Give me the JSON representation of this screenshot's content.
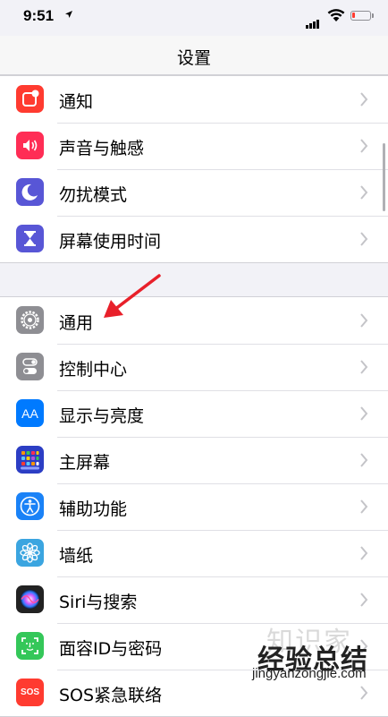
{
  "status_bar": {
    "time": "9:51",
    "location_glyph": "➤",
    "battery_color": "#ff3b30"
  },
  "nav": {
    "title": "设置"
  },
  "groups": [
    {
      "items": [
        {
          "label": "通知",
          "icon": "notifications-icon",
          "color": "#ff3b30"
        },
        {
          "label": "声音与触感",
          "icon": "sounds-icon",
          "color": "#ff2d55"
        },
        {
          "label": "勿扰模式",
          "icon": "moon-icon",
          "color": "#5856d6"
        },
        {
          "label": "屏幕使用时间",
          "icon": "hourglass-icon",
          "color": "#5856d6"
        }
      ]
    },
    {
      "items": [
        {
          "label": "通用",
          "icon": "gear-icon",
          "color": "#8e8e93"
        },
        {
          "label": "控制中心",
          "icon": "toggles-icon",
          "color": "#8e8e93"
        },
        {
          "label": "显示与亮度",
          "icon": "aa-icon",
          "color": "#007aff"
        },
        {
          "label": "主屏幕",
          "icon": "home-grid-icon",
          "color": "#2c3ec4"
        },
        {
          "label": "辅助功能",
          "icon": "accessibility-icon",
          "color": "#1a82f7"
        },
        {
          "label": "墙纸",
          "icon": "flower-icon",
          "color": "#3ba5e0"
        },
        {
          "label": "Siri与搜索",
          "icon": "siri-icon",
          "color": "#222222"
        },
        {
          "label": "面容ID与密码",
          "icon": "face-id-icon",
          "color": "#34c759"
        },
        {
          "label": "SOS紧急联络",
          "icon": "sos-icon",
          "color": "#ff3b30"
        }
      ]
    }
  ],
  "icon_text": {
    "aa": "AA",
    "sos": "SOS"
  },
  "annotation": {
    "arrow_color": "#e8202a"
  },
  "watermark": {
    "line1": "经验总结",
    "line1_faint": "知识家",
    "url": "jingyanzongjie.com"
  }
}
